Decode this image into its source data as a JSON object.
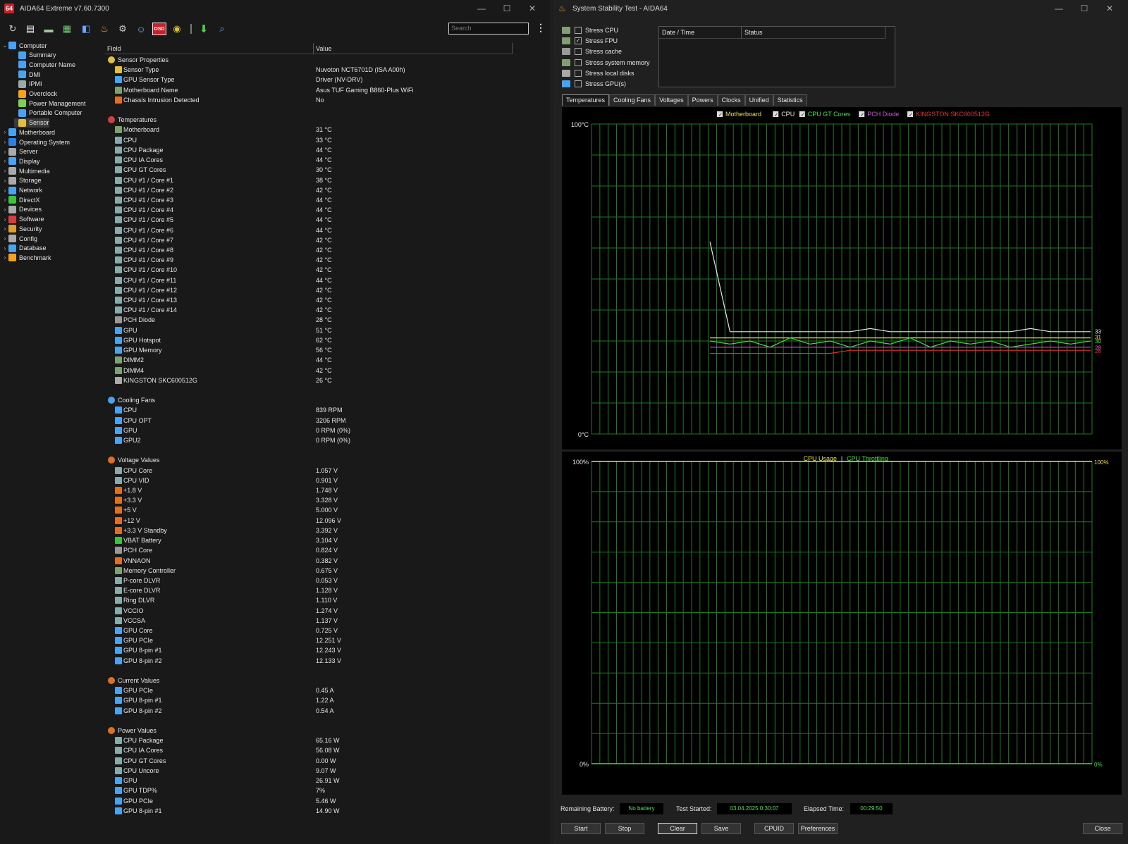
{
  "left_window": {
    "title": "AIDA64 Extreme v7.60.7300",
    "logo": "64",
    "search_placeholder": "Search",
    "toolbar_icons": [
      "refresh-icon",
      "report-icon",
      "motherboard-icon",
      "memory-icon",
      "sysinfo-icon",
      "flame-icon",
      "network-icon",
      "user-icon",
      "osd-icon",
      "sensor-icon",
      "download-icon",
      "search-icon"
    ],
    "osd_label": "OSD"
  },
  "tree": [
    {
      "label": "Computer",
      "level": 0,
      "arrow": "v",
      "color": "#4aa3f0"
    },
    {
      "label": "Summary",
      "level": 1,
      "color": "#4aa3f0"
    },
    {
      "label": "Computer Name",
      "level": 1,
      "color": "#4aa3f0"
    },
    {
      "label": "DMI",
      "level": 1,
      "color": "#4aa3f0"
    },
    {
      "label": "IPMI",
      "level": 1,
      "color": "#9aa"
    },
    {
      "label": "Overclock",
      "level": 1,
      "color": "#f4a21f"
    },
    {
      "label": "Power Management",
      "level": 1,
      "color": "#7fd04f"
    },
    {
      "label": "Portable Computer",
      "level": 1,
      "color": "#4aa3f0"
    },
    {
      "label": "Sensor",
      "level": 1,
      "color": "#e0c040",
      "selected": true
    },
    {
      "label": "Motherboard",
      "level": 0,
      "arrow": ">",
      "color": "#4aa3f0"
    },
    {
      "label": "Operating System",
      "level": 0,
      "arrow": ">",
      "color": "#3080e0"
    },
    {
      "label": "Server",
      "level": 0,
      "arrow": ">",
      "color": "#aaa"
    },
    {
      "label": "Display",
      "level": 0,
      "arrow": ">",
      "color": "#4aa3f0"
    },
    {
      "label": "Multimedia",
      "level": 0,
      "arrow": ">",
      "color": "#aaa"
    },
    {
      "label": "Storage",
      "level": 0,
      "arrow": ">",
      "color": "#aaa"
    },
    {
      "label": "Network",
      "level": 0,
      "arrow": ">",
      "color": "#4aa3f0"
    },
    {
      "label": "DirectX",
      "level": 0,
      "arrow": ">",
      "color": "#40c040"
    },
    {
      "label": "Devices",
      "level": 0,
      "arrow": ">",
      "color": "#aaa"
    },
    {
      "label": "Software",
      "level": 0,
      "arrow": ">",
      "color": "#d04040"
    },
    {
      "label": "Security",
      "level": 0,
      "arrow": ">",
      "color": "#e0a030"
    },
    {
      "label": "Config",
      "level": 0,
      "arrow": ">",
      "color": "#aaa"
    },
    {
      "label": "Database",
      "level": 0,
      "arrow": ">",
      "color": "#4aa3f0"
    },
    {
      "label": "Benchmark",
      "level": 0,
      "arrow": ">",
      "color": "#f4a21f"
    }
  ],
  "grid": {
    "col_field": "Field",
    "col_value": "Value",
    "rows": [
      {
        "g": "Sensor Properties",
        "c": "#e0c040"
      },
      {
        "f": "Sensor Type",
        "v": "Nuvoton NCT6701D  (ISA A00h)",
        "c": "#e0c040"
      },
      {
        "f": "GPU Sensor Type",
        "v": "Driver  (NV-DRV)",
        "c": "#4aa3f0"
      },
      {
        "f": "Motherboard Name",
        "v": "Asus TUF Gaming B860-Plus WiFi",
        "c": "#7fa070"
      },
      {
        "f": "Chassis Intrusion Detected",
        "v": "No",
        "c": "#e07020"
      },
      {
        "blank": true
      },
      {
        "g": "Temperatures",
        "c": "#d04040"
      },
      {
        "f": "Motherboard",
        "v": "31 °C",
        "c": "#7fa070"
      },
      {
        "f": "CPU",
        "v": "33 °C",
        "c": "#8aa"
      },
      {
        "f": "CPU Package",
        "v": "44 °C",
        "c": "#8aa"
      },
      {
        "f": "CPU IA Cores",
        "v": "44 °C",
        "c": "#8aa"
      },
      {
        "f": "CPU GT Cores",
        "v": "30 °C",
        "c": "#8aa"
      },
      {
        "f": "CPU #1 / Core #1",
        "v": "38 °C",
        "c": "#8aa"
      },
      {
        "f": "CPU #1 / Core #2",
        "v": "42 °C",
        "c": "#8aa"
      },
      {
        "f": "CPU #1 / Core #3",
        "v": "44 °C",
        "c": "#8aa"
      },
      {
        "f": "CPU #1 / Core #4",
        "v": "44 °C",
        "c": "#8aa"
      },
      {
        "f": "CPU #1 / Core #5",
        "v": "44 °C",
        "c": "#8aa"
      },
      {
        "f": "CPU #1 / Core #6",
        "v": "44 °C",
        "c": "#8aa"
      },
      {
        "f": "CPU #1 / Core #7",
        "v": "42 °C",
        "c": "#8aa"
      },
      {
        "f": "CPU #1 / Core #8",
        "v": "42 °C",
        "c": "#8aa"
      },
      {
        "f": "CPU #1 / Core #9",
        "v": "42 °C",
        "c": "#8aa"
      },
      {
        "f": "CPU #1 / Core #10",
        "v": "42 °C",
        "c": "#8aa"
      },
      {
        "f": "CPU #1 / Core #11",
        "v": "44 °C",
        "c": "#8aa"
      },
      {
        "f": "CPU #1 / Core #12",
        "v": "42 °C",
        "c": "#8aa"
      },
      {
        "f": "CPU #1 / Core #13",
        "v": "42 °C",
        "c": "#8aa"
      },
      {
        "f": "CPU #1 / Core #14",
        "v": "42 °C",
        "c": "#8aa"
      },
      {
        "f": "PCH Diode",
        "v": "28 °C",
        "c": "#999"
      },
      {
        "f": "GPU",
        "v": "51 °C",
        "c": "#4aa3f0"
      },
      {
        "f": "GPU Hotspot",
        "v": "62 °C",
        "c": "#4aa3f0"
      },
      {
        "f": "GPU Memory",
        "v": "56 °C",
        "c": "#4aa3f0"
      },
      {
        "f": "DIMM2",
        "v": "44 °C",
        "c": "#7fa070"
      },
      {
        "f": "DIMM4",
        "v": "42 °C",
        "c": "#7fa070"
      },
      {
        "f": "KINGSTON SKC600512G",
        "v": "26 °C",
        "c": "#aaa"
      },
      {
        "blank": true
      },
      {
        "g": "Cooling Fans",
        "c": "#4aa3f0"
      },
      {
        "f": "CPU",
        "v": "839 RPM",
        "c": "#4aa3f0"
      },
      {
        "f": "CPU OPT",
        "v": "3206 RPM",
        "c": "#4aa3f0"
      },
      {
        "f": "GPU",
        "v": "0 RPM  (0%)",
        "c": "#4aa3f0"
      },
      {
        "f": "GPU2",
        "v": "0 RPM  (0%)",
        "c": "#4aa3f0"
      },
      {
        "blank": true
      },
      {
        "g": "Voltage Values",
        "c": "#e07020"
      },
      {
        "f": "CPU Core",
        "v": "1.057 V",
        "c": "#8aa"
      },
      {
        "f": "CPU VID",
        "v": "0.901 V",
        "c": "#8aa"
      },
      {
        "f": "+1.8 V",
        "v": "1.748 V",
        "c": "#e07020"
      },
      {
        "f": "+3.3 V",
        "v": "3.328 V",
        "c": "#e07020"
      },
      {
        "f": "+5 V",
        "v": "5.000 V",
        "c": "#e07020"
      },
      {
        "f": "+12 V",
        "v": "12.096 V",
        "c": "#e07020"
      },
      {
        "f": "+3.3 V Standby",
        "v": "3.392 V",
        "c": "#e07020"
      },
      {
        "f": "VBAT Battery",
        "v": "3.104 V",
        "c": "#40c040"
      },
      {
        "f": "PCH Core",
        "v": "0.824 V",
        "c": "#999"
      },
      {
        "f": "VNNAON",
        "v": "0.382 V",
        "c": "#e07020"
      },
      {
        "f": "Memory Controller",
        "v": "0.675 V",
        "c": "#7fa070"
      },
      {
        "f": "P-core DLVR",
        "v": "0.053 V",
        "c": "#8aa"
      },
      {
        "f": "E-core DLVR",
        "v": "1.128 V",
        "c": "#8aa"
      },
      {
        "f": "Ring DLVR",
        "v": "1.110 V",
        "c": "#8aa"
      },
      {
        "f": "VCCIO",
        "v": "1.274 V",
        "c": "#8aa"
      },
      {
        "f": "VCCSA",
        "v": "1.137 V",
        "c": "#8aa"
      },
      {
        "f": "GPU Core",
        "v": "0.725 V",
        "c": "#4aa3f0"
      },
      {
        "f": "GPU PCIe",
        "v": "12.251 V",
        "c": "#4aa3f0"
      },
      {
        "f": "GPU 8-pin #1",
        "v": "12.243 V",
        "c": "#4aa3f0"
      },
      {
        "f": "GPU 8-pin #2",
        "v": "12.133 V",
        "c": "#4aa3f0"
      },
      {
        "blank": true
      },
      {
        "g": "Current Values",
        "c": "#e07020"
      },
      {
        "f": "GPU PCIe",
        "v": "0.45 A",
        "c": "#4aa3f0"
      },
      {
        "f": "GPU 8-pin #1",
        "v": "1.22 A",
        "c": "#4aa3f0"
      },
      {
        "f": "GPU 8-pin #2",
        "v": "0.54 A",
        "c": "#4aa3f0"
      },
      {
        "blank": true
      },
      {
        "g": "Power Values",
        "c": "#e07020"
      },
      {
        "f": "CPU Package",
        "v": "65.16 W",
        "c": "#8aa"
      },
      {
        "f": "CPU IA Cores",
        "v": "56.08 W",
        "c": "#8aa"
      },
      {
        "f": "CPU GT Cores",
        "v": "0.00 W",
        "c": "#8aa"
      },
      {
        "f": "CPU Uncore",
        "v": "9.07 W",
        "c": "#8aa"
      },
      {
        "f": "GPU",
        "v": "26.91 W",
        "c": "#4aa3f0"
      },
      {
        "f": "GPU TDP%",
        "v": "7%",
        "c": "#4aa3f0"
      },
      {
        "f": "GPU PCIe",
        "v": "5.46 W",
        "c": "#4aa3f0"
      },
      {
        "f": "GPU 8-pin #1",
        "v": "14.90 W",
        "c": "#4aa3f0"
      }
    ]
  },
  "right_window": {
    "title": "System Stability Test - AIDA64",
    "stress_options": [
      {
        "label": "Stress CPU",
        "checked": false,
        "color": "#7fa070"
      },
      {
        "label": "Stress FPU",
        "checked": true,
        "color": "#7fa070"
      },
      {
        "label": "Stress cache",
        "checked": false,
        "color": "#999"
      },
      {
        "label": "Stress system memory",
        "checked": false,
        "color": "#7fa070"
      },
      {
        "label": "Stress local disks",
        "checked": false,
        "color": "#aaa"
      },
      {
        "label": "Stress GPU(s)",
        "checked": false,
        "color": "#4aa3f0"
      }
    ],
    "log_cols": [
      "Date / Time",
      "Status"
    ],
    "tabs": [
      "Temperatures",
      "Cooling Fans",
      "Voltages",
      "Powers",
      "Clocks",
      "Unified",
      "Statistics"
    ],
    "active_tab": "Temperatures",
    "bottom": {
      "battery_label": "Remaining Battery:",
      "battery_value": "No battery",
      "started_label": "Test Started:",
      "started_value": "03.04.2025 0:30:07",
      "elapsed_label": "Elapsed Time:",
      "elapsed_value": "00:29:50"
    },
    "buttons": [
      "Start",
      "Stop",
      "Clear",
      "Save",
      "CPUID",
      "Preferences",
      "Close"
    ]
  },
  "chart_data": [
    {
      "type": "line",
      "ylim": [
        0,
        100
      ],
      "ytick_top": "100°C",
      "ytick_bottom": "0°C",
      "grid": true,
      "legend_placement": "top-center",
      "series": [
        {
          "name": "Motherboard",
          "color": "#e8e05a",
          "value_label": "31",
          "values": [
            31,
            31,
            31,
            31,
            31,
            31,
            31,
            31,
            31,
            31,
            31,
            31,
            31,
            31,
            31,
            31,
            31,
            31,
            31,
            31
          ]
        },
        {
          "name": "CPU",
          "color": "#e6e6e6",
          "value_label": "33",
          "values": [
            62,
            33,
            33,
            33,
            33,
            33,
            33,
            33,
            34,
            33,
            33,
            33,
            33,
            33,
            33,
            33,
            34,
            33,
            33,
            33
          ]
        },
        {
          "name": "CPU GT Cores",
          "color": "#40e040",
          "value_label": "30",
          "values": [
            30,
            29,
            30,
            28,
            31,
            29,
            30,
            28,
            30,
            29,
            31,
            28,
            30,
            29,
            30,
            28,
            29,
            30,
            29,
            30
          ]
        },
        {
          "name": "PCH Diode",
          "color": "#d050d0",
          "value_label": "28",
          "values": [
            28,
            28,
            28,
            28,
            28,
            28,
            28,
            28,
            28,
            28,
            28,
            28,
            28,
            28,
            28,
            28,
            28,
            28,
            28,
            28
          ]
        },
        {
          "name": "KINGSTON SKC600512G",
          "color": "#e03030",
          "value_label": "26",
          "values": [
            26,
            26,
            26,
            26,
            26,
            26,
            26,
            27,
            27,
            27,
            27,
            27,
            27,
            27,
            27,
            27,
            27,
            27,
            27,
            27
          ]
        }
      ]
    },
    {
      "type": "line",
      "ylim": [
        0,
        100
      ],
      "ytick_top": "100%",
      "ytick_bottom": "0%",
      "right_top": "100%",
      "right_bottom": "0%",
      "grid": true,
      "series": [
        {
          "name": "CPU Usage",
          "color": "#e8e05a",
          "values": [
            100,
            100,
            100,
            100,
            100,
            100,
            100,
            100,
            100,
            100
          ]
        },
        {
          "name": "CPU Throttling",
          "color": "#40e040",
          "values": [
            0,
            0,
            0,
            0,
            0,
            0,
            0,
            0,
            0,
            0
          ]
        }
      ]
    }
  ]
}
